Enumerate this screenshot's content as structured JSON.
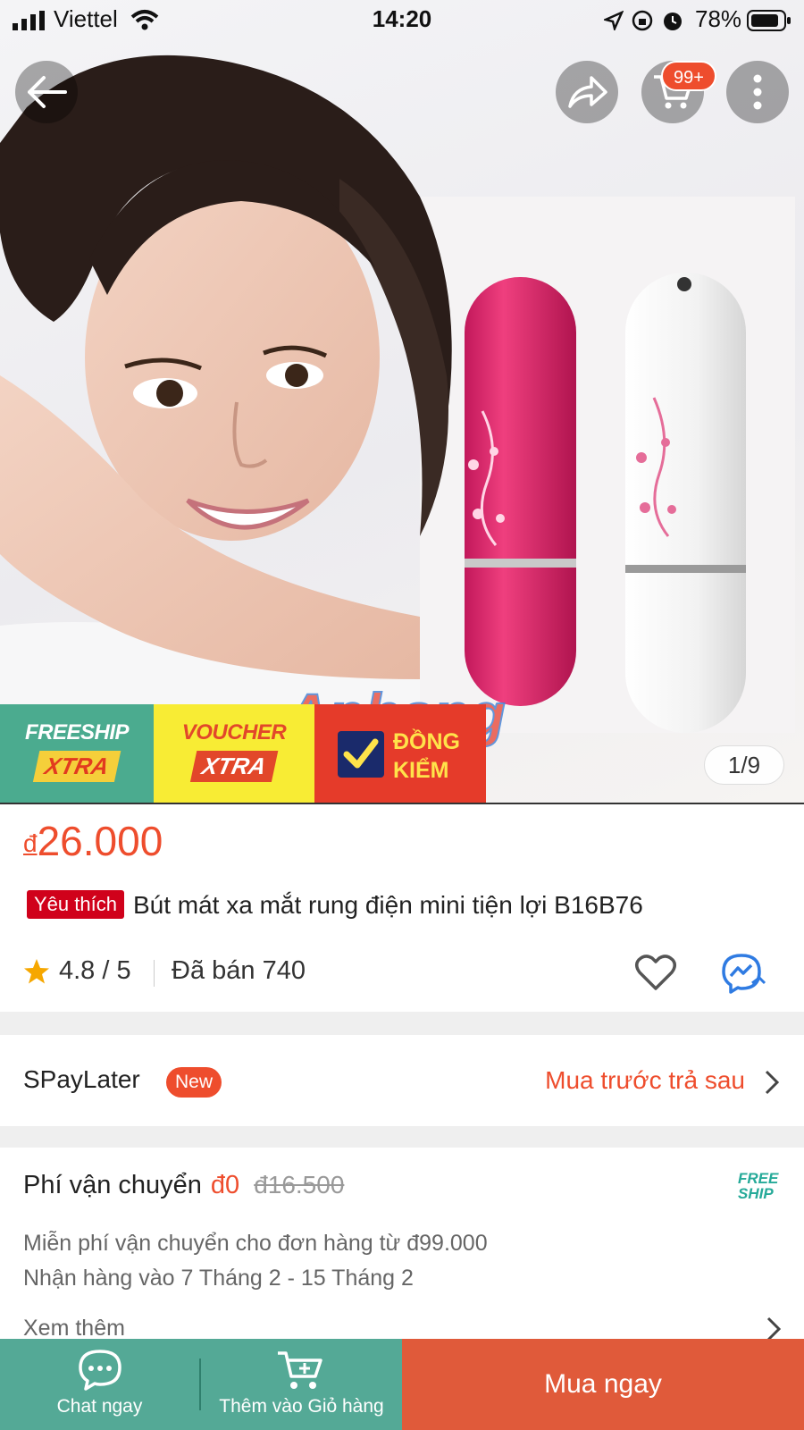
{
  "status_bar": {
    "carrier": "Viettel",
    "time": "14:20",
    "battery": "78%"
  },
  "nav": {
    "cart_badge": "99+"
  },
  "gallery": {
    "counter": "1/9",
    "watermark": "Aphang"
  },
  "promo_badges": {
    "freeship_top": "FREESHIP",
    "freeship_bottom": "XTRA",
    "voucher_top": "VOUCHER",
    "voucher_bottom": "XTRA",
    "dongkiem_line1": "ĐỒNG",
    "dongkiem_line2": "KIỂM"
  },
  "product": {
    "currency": "đ",
    "price": "26.000",
    "favorite_tag": "Yêu thích",
    "title": "Bút mát xa mắt rung điện mini tiện lợi B16B76",
    "rating": "4.8 / 5",
    "sold": "Đã bán 740"
  },
  "spaylater": {
    "label": "SPayLater",
    "new_tag": "New",
    "link": "Mua trước trả sau"
  },
  "shipping": {
    "title": "Phí vận chuyển",
    "fee": "đ0",
    "old_fee": "đ16.500",
    "logo_line1": "FREE",
    "logo_line2": "SHIP",
    "line1": "Miễn phí vận chuyển cho đơn hàng từ đ99.000",
    "line2": "Nhận hàng vào 7 Tháng 2 - 15 Tháng 2",
    "more": "Xem thêm"
  },
  "bottom_bar": {
    "chat": "Chat ngay",
    "add_to_cart": "Thêm vào Giỏ hàng",
    "buy_now": "Mua ngay"
  },
  "colors": {
    "brand": "#ee4d2d",
    "bottom_left": "#54a996",
    "buy_button": "#e05a3a",
    "freeship_badge": "#4bab8f",
    "voucher_badge": "#f8ec34"
  }
}
